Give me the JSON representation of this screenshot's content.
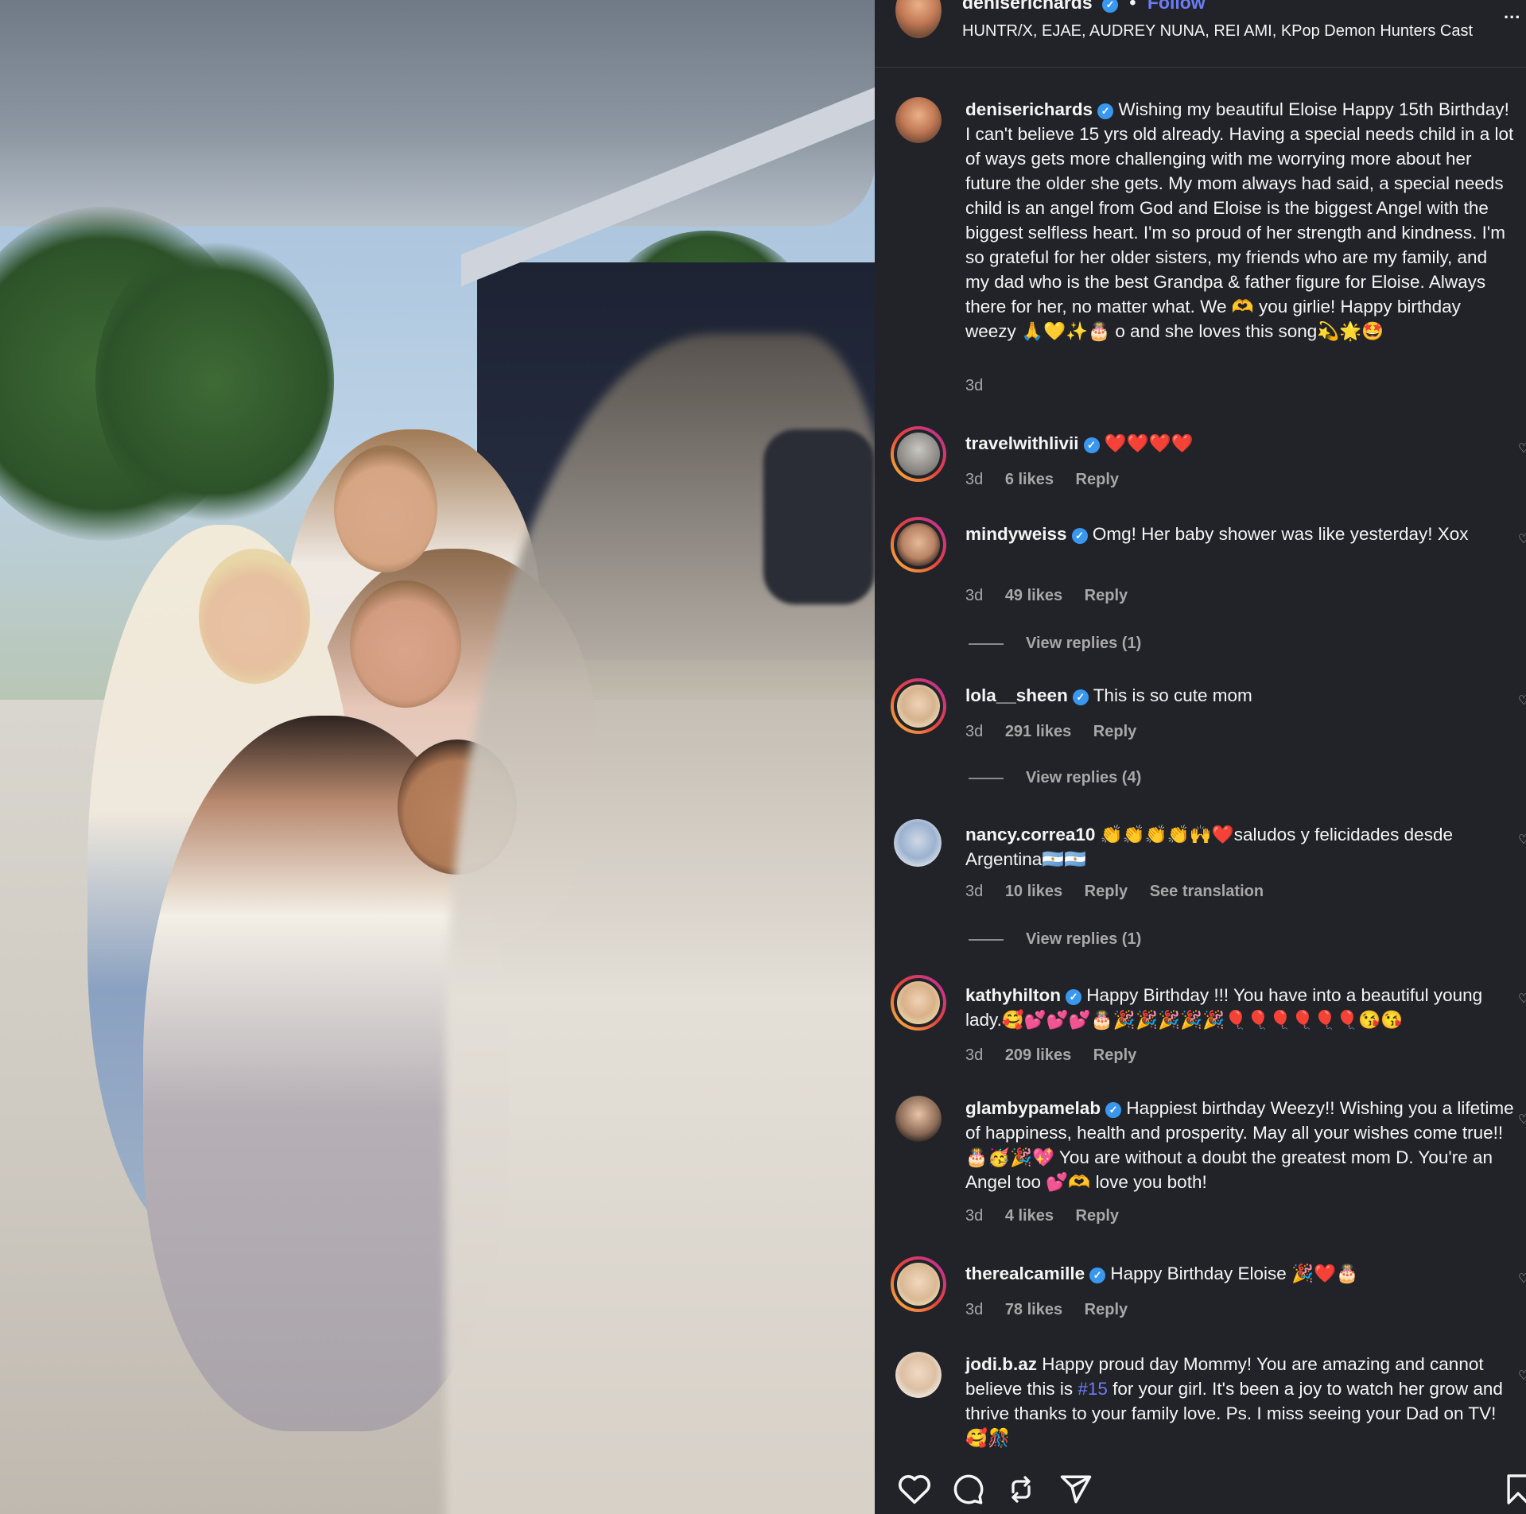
{
  "header": {
    "username": "deniserichards",
    "separator": "•",
    "follow_label": "Follow",
    "music": "HUNTR/X, EJAE, AUDREY NUNA, REI AMI, KPop Demon Hunters Cast",
    "more": "..."
  },
  "caption": {
    "username": "deniserichards",
    "text": "Wishing my beautiful Eloise Happy 15th Birthday! I can't believe 15 yrs old already. Having a special needs child in a lot of ways gets more challenging with me worrying more about her future the older she gets. My mom always had said, a special needs child is an angel from God and Eloise is the biggest Angel with the biggest selfless heart. I'm so proud of her strength and kindness. I'm so grateful for her older sisters, my friends who are my family, and my dad who is the best Grandpa & father figure for Eloise. Always there for her, no matter what. We 🫶 you girlie! Happy birthday weezy 🙏💛✨🎂 o and she loves this song💫🌟🤩",
    "time": "3d"
  },
  "comments": [
    {
      "username": "travelwithlivii",
      "verified": true,
      "text": "❤️❤️❤️❤️",
      "time": "3d",
      "likes": "6 likes",
      "reply": "Reply"
    },
    {
      "username": "mindyweiss",
      "verified": true,
      "text": "Omg! Her baby shower was like yesterday! Xox",
      "time": "3d",
      "likes": "49 likes",
      "reply": "Reply",
      "view_replies": "View replies (1)"
    },
    {
      "username": "lola__sheen",
      "verified": true,
      "text": "This is so cute mom",
      "time": "3d",
      "likes": "291 likes",
      "reply": "Reply",
      "view_replies": "View replies (4)"
    },
    {
      "username": "nancy.correa10",
      "verified": false,
      "text": "👏👏👏👏🙌❤️saludos y felicidades desde Argentina🇦🇷🇦🇷",
      "time": "3d",
      "likes": "10 likes",
      "reply": "Reply",
      "translate": "See translation",
      "view_replies": "View replies (1)"
    },
    {
      "username": "kathyhilton",
      "verified": true,
      "text": "Happy Birthday !!! You have into a beautiful young lady.🥰💕💕💕🎂🎉🎉🎉🎉🎉🎈🎈🎈🎈🎈🎈😘😘",
      "time": "3d",
      "likes": "209 likes",
      "reply": "Reply"
    },
    {
      "username": "glambypamelab",
      "verified": true,
      "text": "Happiest birthday Weezy!! Wishing you a lifetime of happiness, health and prosperity. May all your wishes come true!! 🎂🥳🎉💖 You are without a doubt the greatest mom D. You're an Angel too 💕🫶 love you both!",
      "time": "3d",
      "likes": "4 likes",
      "reply": "Reply"
    },
    {
      "username": "therealcamille",
      "verified": true,
      "text": "Happy Birthday Eloise 🎉❤️🎂",
      "time": "3d",
      "likes": "78 likes",
      "reply": "Reply"
    },
    {
      "username": "jodi.b.az",
      "verified": false,
      "text_before": "Happy proud day Mommy! You are amazing and cannot believe this is ",
      "hashtag": "#15",
      "text_after": " for your girl. It's been a joy to watch her grow and thrive thanks to your family love. Ps. I miss seeing your Dad on TV! 🥰🎊"
    }
  ],
  "icons": {
    "verified": "verified-badge-icon",
    "like": "heart-icon",
    "comment": "comment-icon",
    "repost": "repost-icon",
    "share": "share-icon",
    "save": "bookmark-icon"
  },
  "colors": {
    "panel_bg": "#212328",
    "text": "#f5f5f5",
    "muted": "#a8a8a8",
    "link": "#6b7cf5",
    "verified": "#3a97f0"
  }
}
